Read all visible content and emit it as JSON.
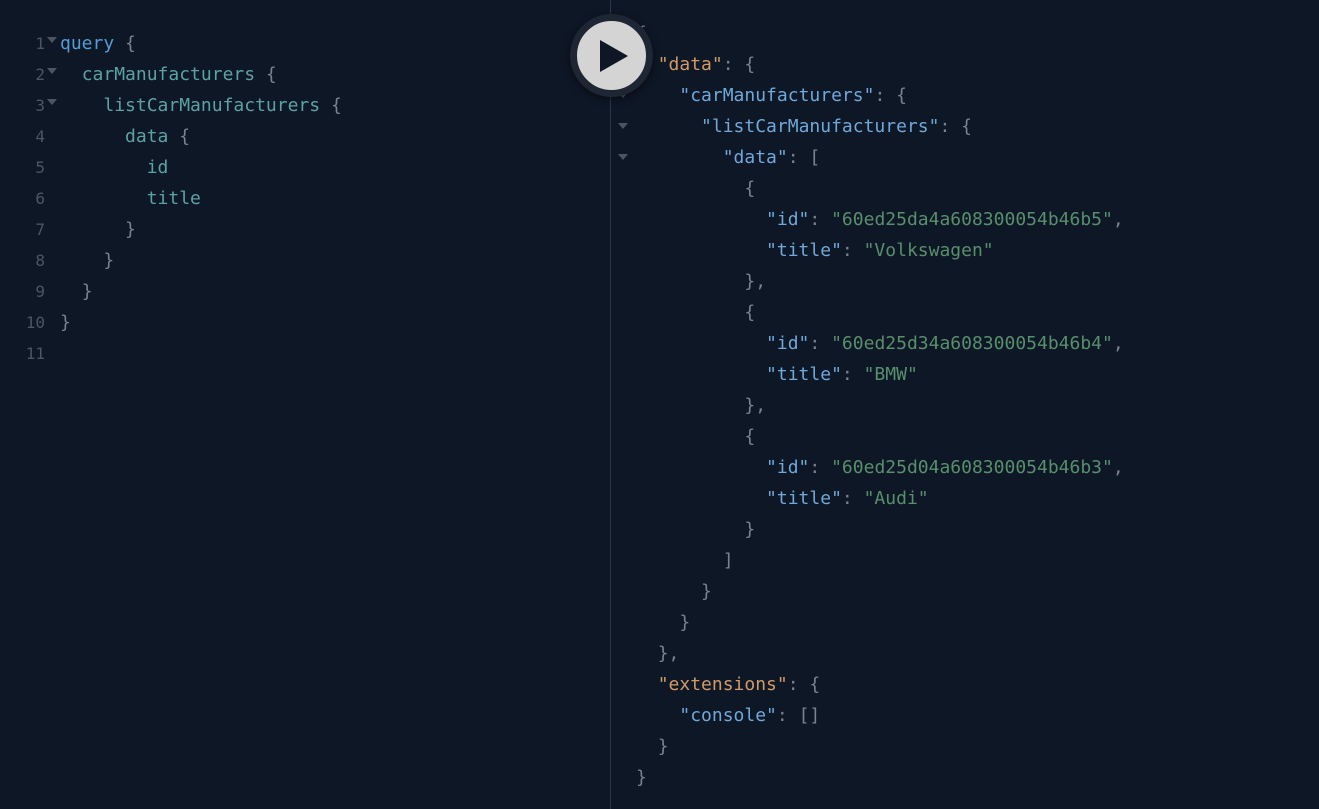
{
  "query": {
    "lines": [
      {
        "num": "1",
        "fold": true,
        "indent": 0,
        "tokens": [
          {
            "t": "query",
            "c": "keyword"
          },
          {
            "t": " {",
            "c": "punct"
          }
        ]
      },
      {
        "num": "2",
        "fold": true,
        "indent": 1,
        "tokens": [
          {
            "t": "carManufacturers",
            "c": "field"
          },
          {
            "t": " {",
            "c": "punct"
          }
        ]
      },
      {
        "num": "3",
        "fold": true,
        "indent": 2,
        "tokens": [
          {
            "t": "listCarManufacturers",
            "c": "field"
          },
          {
            "t": " {",
            "c": "punct"
          }
        ]
      },
      {
        "num": "4",
        "fold": false,
        "indent": 3,
        "tokens": [
          {
            "t": "data",
            "c": "field"
          },
          {
            "t": " {",
            "c": "punct"
          }
        ]
      },
      {
        "num": "5",
        "fold": false,
        "indent": 4,
        "tokens": [
          {
            "t": "id",
            "c": "field"
          }
        ]
      },
      {
        "num": "6",
        "fold": false,
        "indent": 4,
        "tokens": [
          {
            "t": "title",
            "c": "field"
          }
        ]
      },
      {
        "num": "7",
        "fold": false,
        "indent": 3,
        "tokens": [
          {
            "t": "}",
            "c": "punct"
          }
        ]
      },
      {
        "num": "8",
        "fold": false,
        "indent": 2,
        "tokens": [
          {
            "t": "}",
            "c": "punct"
          }
        ]
      },
      {
        "num": "9",
        "fold": false,
        "indent": 1,
        "tokens": [
          {
            "t": "}",
            "c": "punct"
          }
        ]
      },
      {
        "num": "10",
        "fold": false,
        "indent": 0,
        "tokens": [
          {
            "t": "}",
            "c": "punct"
          }
        ]
      },
      {
        "num": "11",
        "fold": false,
        "indent": 0,
        "tokens": []
      }
    ]
  },
  "result": {
    "lines": [
      {
        "fold": true,
        "indent": 0,
        "tokens": [
          {
            "t": "{",
            "c": "punct"
          }
        ]
      },
      {
        "fold": true,
        "indent": 1,
        "tokens": [
          {
            "t": "\"data\"",
            "c": "orange-prop"
          },
          {
            "t": ": {",
            "c": "punct"
          }
        ]
      },
      {
        "fold": true,
        "indent": 2,
        "tokens": [
          {
            "t": "\"carManufacturers\"",
            "c": "prop"
          },
          {
            "t": ": {",
            "c": "punct"
          }
        ]
      },
      {
        "fold": true,
        "indent": 3,
        "tokens": [
          {
            "t": "\"listCarManufacturers\"",
            "c": "prop"
          },
          {
            "t": ": {",
            "c": "punct"
          }
        ]
      },
      {
        "fold": true,
        "indent": 4,
        "tokens": [
          {
            "t": "\"data\"",
            "c": "prop"
          },
          {
            "t": ": [",
            "c": "punct"
          }
        ]
      },
      {
        "fold": false,
        "indent": 5,
        "tokens": [
          {
            "t": "{",
            "c": "punct"
          }
        ]
      },
      {
        "fold": false,
        "indent": 6,
        "tokens": [
          {
            "t": "\"id\"",
            "c": "prop"
          },
          {
            "t": ": ",
            "c": "punct"
          },
          {
            "t": "\"60ed25da4a608300054b46b5\"",
            "c": "green-string"
          },
          {
            "t": ",",
            "c": "punct"
          }
        ]
      },
      {
        "fold": false,
        "indent": 6,
        "tokens": [
          {
            "t": "\"title\"",
            "c": "prop"
          },
          {
            "t": ": ",
            "c": "punct"
          },
          {
            "t": "\"Volkswagen\"",
            "c": "green-string"
          }
        ]
      },
      {
        "fold": false,
        "indent": 5,
        "tokens": [
          {
            "t": "},",
            "c": "punct"
          }
        ]
      },
      {
        "fold": false,
        "indent": 5,
        "tokens": [
          {
            "t": "{",
            "c": "punct"
          }
        ]
      },
      {
        "fold": false,
        "indent": 6,
        "tokens": [
          {
            "t": "\"id\"",
            "c": "prop"
          },
          {
            "t": ": ",
            "c": "punct"
          },
          {
            "t": "\"60ed25d34a608300054b46b4\"",
            "c": "green-string"
          },
          {
            "t": ",",
            "c": "punct"
          }
        ]
      },
      {
        "fold": false,
        "indent": 6,
        "tokens": [
          {
            "t": "\"title\"",
            "c": "prop"
          },
          {
            "t": ": ",
            "c": "punct"
          },
          {
            "t": "\"BMW\"",
            "c": "green-string"
          }
        ]
      },
      {
        "fold": false,
        "indent": 5,
        "tokens": [
          {
            "t": "},",
            "c": "punct"
          }
        ]
      },
      {
        "fold": false,
        "indent": 5,
        "tokens": [
          {
            "t": "{",
            "c": "punct"
          }
        ]
      },
      {
        "fold": false,
        "indent": 6,
        "tokens": [
          {
            "t": "\"id\"",
            "c": "prop"
          },
          {
            "t": ": ",
            "c": "punct"
          },
          {
            "t": "\"60ed25d04a608300054b46b3\"",
            "c": "green-string"
          },
          {
            "t": ",",
            "c": "punct"
          }
        ]
      },
      {
        "fold": false,
        "indent": 6,
        "tokens": [
          {
            "t": "\"title\"",
            "c": "prop"
          },
          {
            "t": ": ",
            "c": "punct"
          },
          {
            "t": "\"Audi\"",
            "c": "green-string"
          }
        ]
      },
      {
        "fold": false,
        "indent": 5,
        "tokens": [
          {
            "t": "}",
            "c": "punct"
          }
        ]
      },
      {
        "fold": false,
        "indent": 4,
        "tokens": [
          {
            "t": "]",
            "c": "punct"
          }
        ]
      },
      {
        "fold": false,
        "indent": 3,
        "tokens": [
          {
            "t": "}",
            "c": "punct"
          }
        ]
      },
      {
        "fold": false,
        "indent": 2,
        "tokens": [
          {
            "t": "}",
            "c": "punct"
          }
        ]
      },
      {
        "fold": false,
        "indent": 1,
        "tokens": [
          {
            "t": "},",
            "c": "punct"
          }
        ]
      },
      {
        "fold": false,
        "indent": 1,
        "tokens": [
          {
            "t": "\"extensions\"",
            "c": "orange-prop"
          },
          {
            "t": ": {",
            "c": "punct"
          }
        ]
      },
      {
        "fold": false,
        "indent": 2,
        "tokens": [
          {
            "t": "\"console\"",
            "c": "prop"
          },
          {
            "t": ": []",
            "c": "punct"
          }
        ]
      },
      {
        "fold": false,
        "indent": 1,
        "tokens": [
          {
            "t": "}",
            "c": "punct"
          }
        ]
      },
      {
        "fold": false,
        "indent": 0,
        "tokens": [
          {
            "t": "}",
            "c": "punct"
          }
        ]
      }
    ]
  }
}
